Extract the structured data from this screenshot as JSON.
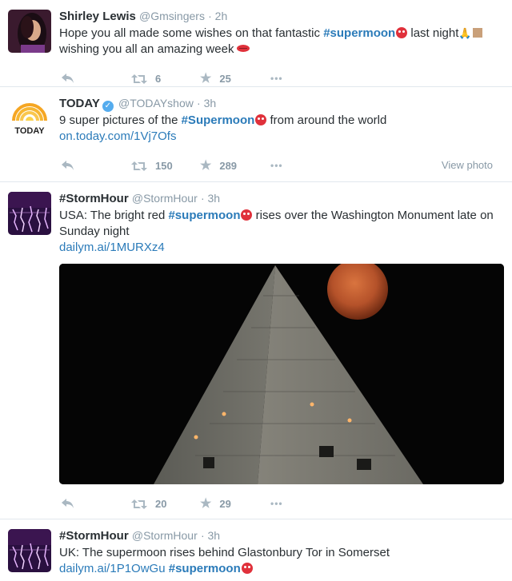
{
  "tweets": [
    {
      "name": "Shirley Lewis",
      "handle": "@Gmsingers",
      "time": "· 2h",
      "text_a": "Hope you all made some wishes on that fantastic ",
      "hashtag": "#supermoon",
      "text_b": " last night",
      "text_c": "wishing you all an amazing week",
      "retweets": "6",
      "favorites": "25"
    },
    {
      "name": "TODAY",
      "handle": "@TODAYshow",
      "time": "· 3h",
      "text_a": "9 super pictures of the ",
      "hashtag": "#Supermoon",
      "text_b": " from around the world",
      "link": "on.today.com/1Vj7Ofs",
      "retweets": "150",
      "favorites": "289",
      "view_photo": "View photo",
      "avatar_label": "TODAY"
    },
    {
      "name": "#StormHour",
      "handle": "@StormHour",
      "time": "· 3h",
      "text_a": "USA: The bright red ",
      "hashtag": "#supermoon",
      "text_b": " rises over the Washington Monument late on Sunday night",
      "link": "dailym.ai/1MURXz4",
      "retweets": "20",
      "favorites": "29"
    },
    {
      "name": "#StormHour",
      "handle": "@StormHour",
      "time": "· 3h",
      "text_a": "UK: The supermoon rises behind Glastonbury Tor in Somerset",
      "link": "dailym.ai/1P1OwGu",
      "hashtag": "#supermoon"
    }
  ],
  "icons": {
    "reply": "reply-icon",
    "retweet": "retweet-icon",
    "favorite": "star-icon",
    "more": "more-icon",
    "verified": "verified-badge-icon"
  },
  "colors": {
    "link": "#2b7bb9",
    "meta": "#8899a6",
    "today_orange": "#f5a623",
    "moon": "#b5522a"
  }
}
